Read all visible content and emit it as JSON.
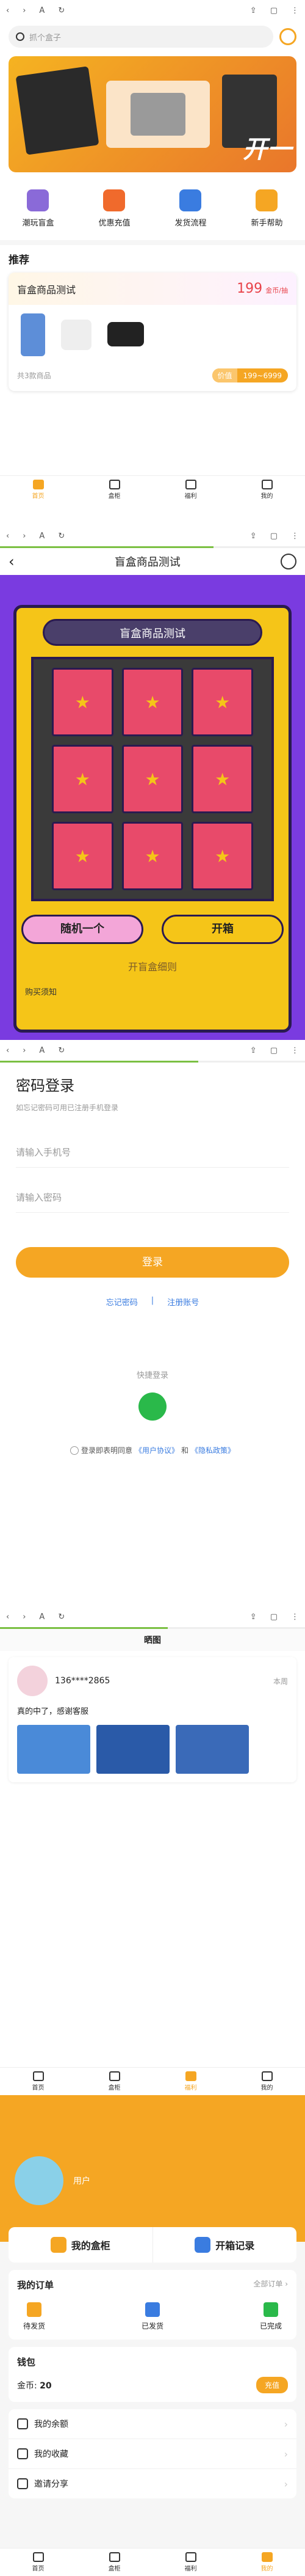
{
  "browser": {
    "back": "‹",
    "fwd": "›",
    "font": "A",
    "reader": "↻",
    "share": "⇪",
    "tabs": "▢",
    "menu": "⋮"
  },
  "home": {
    "search_placeholder": "抓个盒子",
    "banner_text": "开一",
    "features": [
      {
        "label": "潮玩盲盒",
        "color": "#8a6ad8"
      },
      {
        "label": "优惠充值",
        "color": "#f06a2c"
      },
      {
        "label": "发货流程",
        "color": "#3a7ce0"
      },
      {
        "label": "新手帮助",
        "color": "#f5a623"
      }
    ],
    "section_title": "推荐",
    "card": {
      "title": "盲盒商品测试",
      "price": "199",
      "price_unit": "金币/抽",
      "count": "共3款商品",
      "price_range_label": "价值",
      "price_range": "199~6999"
    }
  },
  "tabs": [
    {
      "label": "首页"
    },
    {
      "label": "盒柜"
    },
    {
      "label": "福利"
    },
    {
      "label": "我的"
    }
  ],
  "blindbox": {
    "title": "盲盒商品测试",
    "machine_title": "盲盒商品测试",
    "btn_random": "随机一个",
    "btn_open": "开箱",
    "rules": "开盲盒细则",
    "preview": "购买须知"
  },
  "login": {
    "title": "密码登录",
    "subtitle": "如忘记密码可用已注册手机登录",
    "phone_placeholder": "请输入手机号",
    "password_placeholder": "请输入密码",
    "login_button": "登录",
    "forgot": "忘记密码",
    "sep": "|",
    "register": "注册账号",
    "quick_label": "快捷登录",
    "agree_prefix": "登录即表明同意",
    "agree_user": "《用户协议》",
    "agree_and": "和",
    "agree_privacy": "《隐私政策》"
  },
  "showcase": {
    "title": "晒图",
    "user": "136****2865",
    "date": "本周",
    "text": "真的中了，感谢客服"
  },
  "profile": {
    "username": "用户",
    "box_label": "我的盒柜",
    "records_label": "开箱记录",
    "orders_title": "我的订单",
    "orders_all": "全部订单 ›",
    "order_items": [
      {
        "label": "待发货"
      },
      {
        "label": "已发货"
      },
      {
        "label": "已完成"
      }
    ],
    "wallet_title": "钱包",
    "coins_label": "金币:",
    "coins_value": "20",
    "recharge": "充值",
    "menu": [
      {
        "label": "我的余额"
      },
      {
        "label": "我的收藏"
      },
      {
        "label": "邀请分享"
      }
    ]
  }
}
